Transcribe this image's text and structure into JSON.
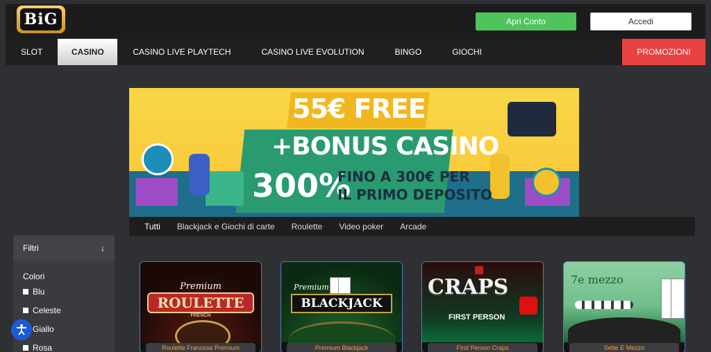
{
  "header": {
    "logo_text": "BiG",
    "open_account_label": "Apri Conto",
    "login_label": "Accedi"
  },
  "nav": {
    "items": [
      {
        "label": "SLOT"
      },
      {
        "label": "CASINO"
      },
      {
        "label": "CASINO LIVE PLAYTECH"
      },
      {
        "label": "CASINO LIVE EVOLUTION"
      },
      {
        "label": "BINGO"
      },
      {
        "label": "GIOCHI"
      }
    ],
    "promo_label": "PROMOZIONI"
  },
  "banner": {
    "line1": "55€ FREE",
    "line2": "+BONUS CASINO",
    "line3_big": "300%",
    "line3_small1": "FINO A 300€ PER",
    "line3_small2": "IL PRIMO DEPOSITO"
  },
  "tabs": [
    {
      "label": "Tutti"
    },
    {
      "label": "Blackjack e Giochi di carte"
    },
    {
      "label": "Roulette"
    },
    {
      "label": "Video poker"
    },
    {
      "label": "Arcade"
    }
  ],
  "filters": {
    "title": "Filtri",
    "colors_title": "Colori",
    "options": [
      "Blu",
      "Celeste",
      "Giallo",
      "Rosa"
    ]
  },
  "games": [
    {
      "title": "Roulette Francese Premium",
      "art_line1": "Premium",
      "art_line2": "ROULETTE",
      "art_line3": "FRENCH"
    },
    {
      "title": "Premium Blackjack",
      "art_line1": "Premium",
      "art_line2": "BLACKJACK",
      "art_line3": ""
    },
    {
      "title": "First Person Craps",
      "art_line1": "CRAPS",
      "art_line2": "FIRST PERSON",
      "art_line3": ""
    },
    {
      "title": "Sette E Mezzo",
      "art_line1": "7e mezzo",
      "art_line2": "",
      "art_line3": ""
    }
  ],
  "colors": {
    "background": "#2f3033",
    "accent_green": "#4fc35c",
    "promo_red": "#e84141",
    "label_orange": "#f29c3e"
  }
}
